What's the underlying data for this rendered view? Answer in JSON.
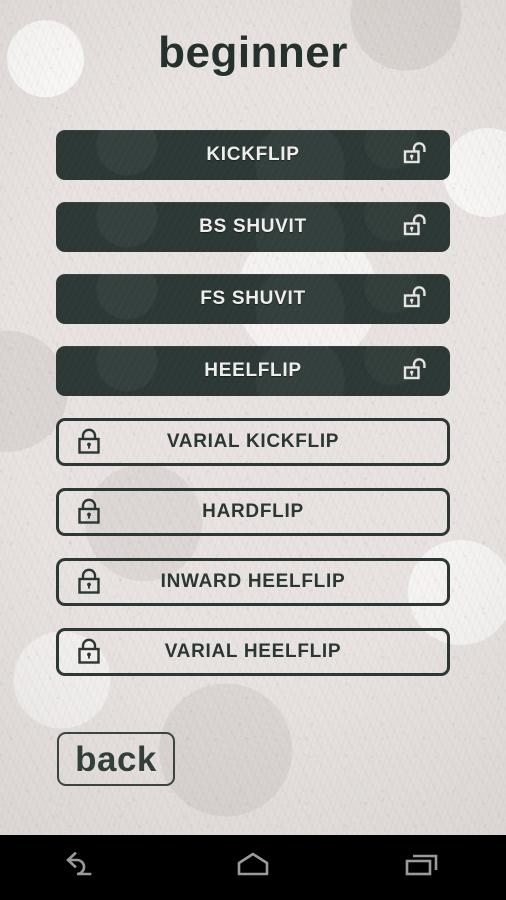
{
  "screen": {
    "title": "beginner",
    "background_color": "#e8e3e0",
    "accent_dark": "#2c3835",
    "text_light": "#f0eeec",
    "text_dark": "#2b3733"
  },
  "tricks": [
    {
      "label": "KICKFLIP",
      "state": "unlocked",
      "icon": "unlock-icon"
    },
    {
      "label": "BS SHUVIT",
      "state": "unlocked",
      "icon": "unlock-icon"
    },
    {
      "label": "FS SHUVIT",
      "state": "unlocked",
      "icon": "unlock-icon"
    },
    {
      "label": "HEELFLIP",
      "state": "unlocked",
      "icon": "unlock-icon"
    },
    {
      "label": "VARIAL KICKFLIP",
      "state": "locked",
      "icon": "lock-icon"
    },
    {
      "label": "HARDFLIP",
      "state": "locked",
      "icon": "lock-icon"
    },
    {
      "label": "INWARD HEELFLIP",
      "state": "locked",
      "icon": "lock-icon"
    },
    {
      "label": "VARIAL HEELFLIP",
      "state": "locked",
      "icon": "lock-icon"
    }
  ],
  "back_button": {
    "label": "back"
  },
  "navbar": {
    "background_color": "#000000",
    "icon_color": "#9a9a9a",
    "buttons": [
      {
        "name": "back-nav-icon",
        "label": "Back"
      },
      {
        "name": "home-nav-icon",
        "label": "Home"
      },
      {
        "name": "recents-nav-icon",
        "label": "Recents"
      }
    ]
  }
}
